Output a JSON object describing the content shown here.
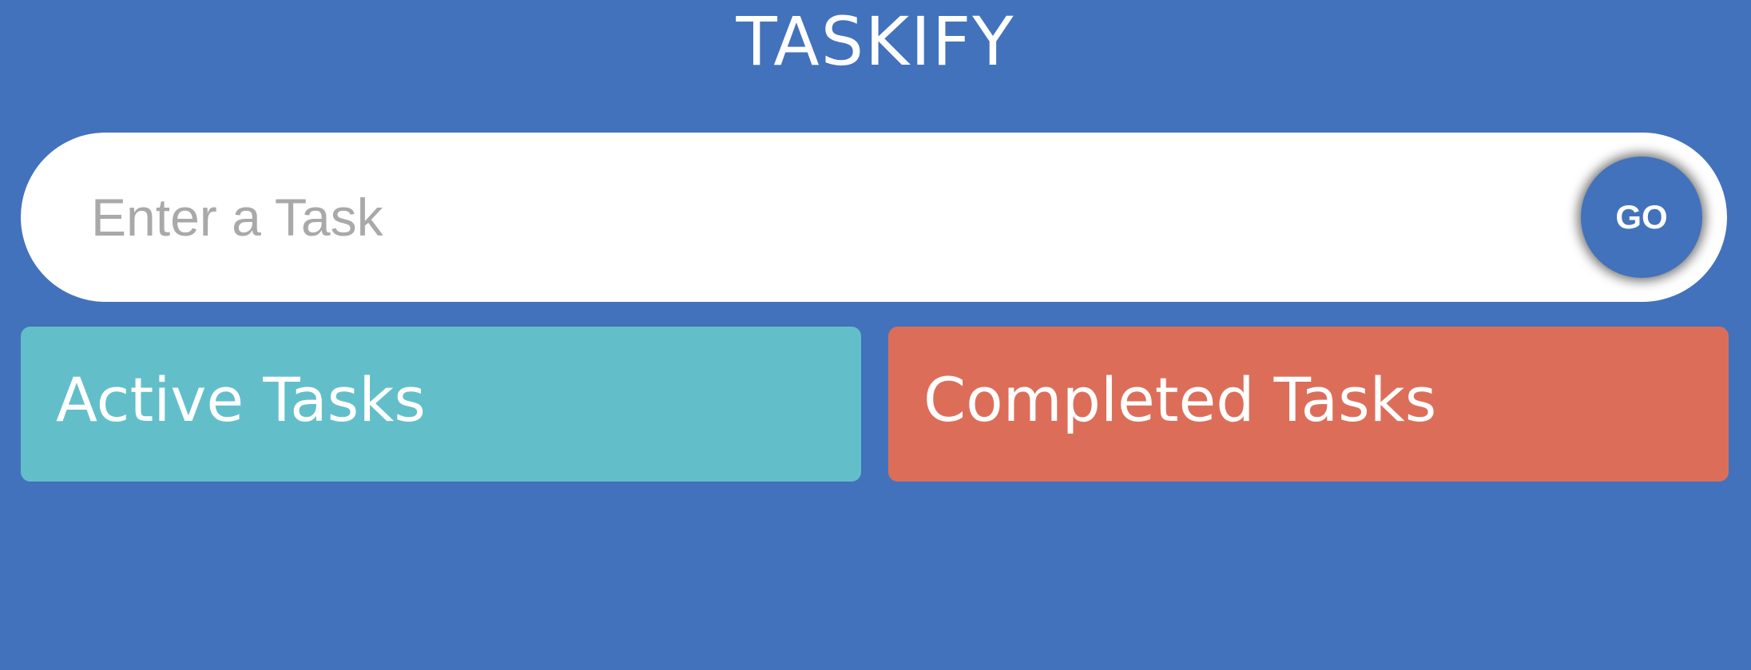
{
  "app": {
    "title": "TASKIFY"
  },
  "task_form": {
    "input_placeholder": "Enter a Task",
    "input_value": "",
    "submit_label": "GO"
  },
  "panels": {
    "active": {
      "heading": "Active Tasks"
    },
    "completed": {
      "heading": "Completed Tasks"
    }
  },
  "colors": {
    "background": "#4272bc",
    "active_panel": "#62bfca",
    "completed_panel": "#dc6e59",
    "input_background": "#ffffff",
    "placeholder_text": "#a9a9a9"
  }
}
